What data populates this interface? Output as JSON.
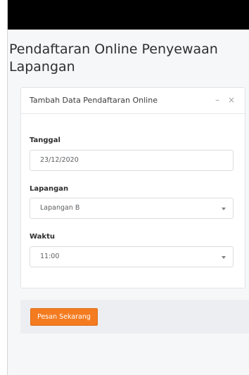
{
  "page": {
    "title": "Pendaftaran Online Penyewaan Lapangan"
  },
  "card": {
    "title": "Tambah Data Pendaftaran Online",
    "minimize_icon": "minus-icon",
    "close_icon": "close-icon"
  },
  "form": {
    "tanggal": {
      "label": "Tanggal",
      "value": "23/12/2020"
    },
    "lapangan": {
      "label": "Lapangan",
      "value": "Lapangan B"
    },
    "waktu": {
      "label": "Waktu",
      "value": "11:00"
    }
  },
  "footer": {
    "submit_label": "Pesan Sekarang"
  },
  "colors": {
    "accent": "#f47b20",
    "topbar": "#000000"
  }
}
